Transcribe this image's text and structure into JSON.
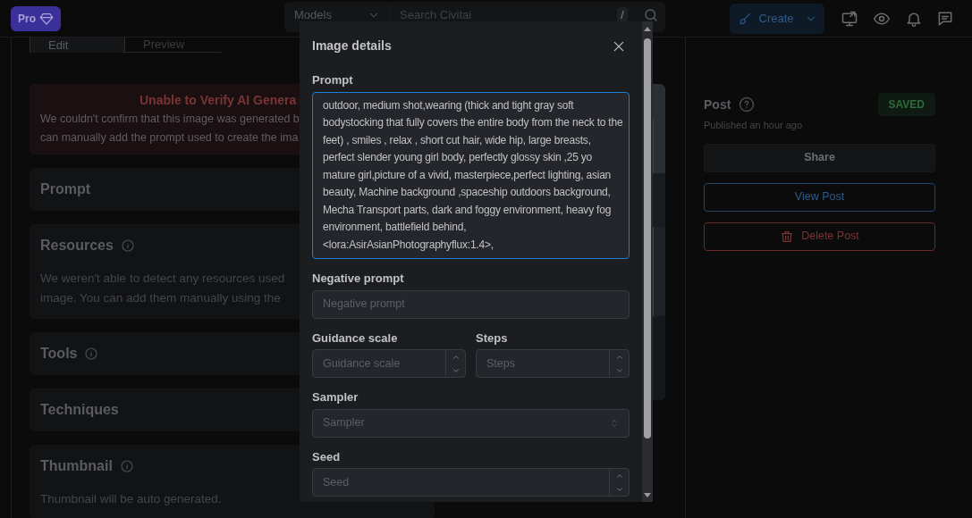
{
  "header": {
    "pro_button": "Pro",
    "search": {
      "category": "Models",
      "placeholder": "Search Civitai",
      "shortcut": "/"
    },
    "create_button": "Create"
  },
  "tabs": [
    {
      "label": "Edit",
      "selected": true
    },
    {
      "label": "Preview",
      "selected": false
    }
  ],
  "alert": {
    "title": "Unable to Verify AI Genera",
    "lines": [
      "We couldn't confirm that this image was generated b",
      "can manually add the prompt used to create the ima"
    ]
  },
  "sections": [
    {
      "title": "Prompt",
      "info": false
    },
    {
      "title": "Resources",
      "info": true,
      "lines": [
        "We weren't able to detect any resources used",
        "image. You can add them manually using the"
      ]
    },
    {
      "title": "Tools",
      "info": true
    },
    {
      "title": "Techniques",
      "info": false
    },
    {
      "title": "Thumbnail",
      "info": true,
      "lines": [
        "Thumbnail will be auto generated."
      ]
    }
  ],
  "post": {
    "title": "Post",
    "status": "SAVED",
    "published": "Published an hour ago",
    "buttons": [
      {
        "kind": "default",
        "label": "Share"
      },
      {
        "kind": "outline",
        "label": "View Post"
      },
      {
        "kind": "danger",
        "label": "Delete Post"
      }
    ]
  },
  "modal": {
    "title": "Image details",
    "fields": [
      {
        "kind": "textarea",
        "label": "Prompt",
        "value": "outdoor, medium shot,wearing (thick and tight  gray soft bodystocking that fully covers the entire body from the neck to the feet) , smiles , relax , short cut hair, wide hip, large breasts, perfect slender young girl body, perfectly glossy skin ,25 yo mature girl,picture of a vivid, masterpiece,perfect lighting, asian beauty, Machine background ,spaceship outdoors background, Mecha Transport parts, dark and foggy environment, heavy fog environment, battlefield behind, <lora:AsirAsianPhotographyflux:1.4>,"
      },
      {
        "kind": "text",
        "label": "Negative prompt",
        "placeholder": "Negative prompt"
      },
      {
        "kind": "pair",
        "items": [
          {
            "label": "Guidance scale",
            "placeholder": "Guidance scale"
          },
          {
            "label": "Steps",
            "placeholder": "Steps"
          }
        ]
      },
      {
        "kind": "select",
        "label": "Sampler",
        "placeholder": "Sampler"
      },
      {
        "kind": "number",
        "label": "Seed",
        "placeholder": "Seed"
      }
    ]
  }
}
